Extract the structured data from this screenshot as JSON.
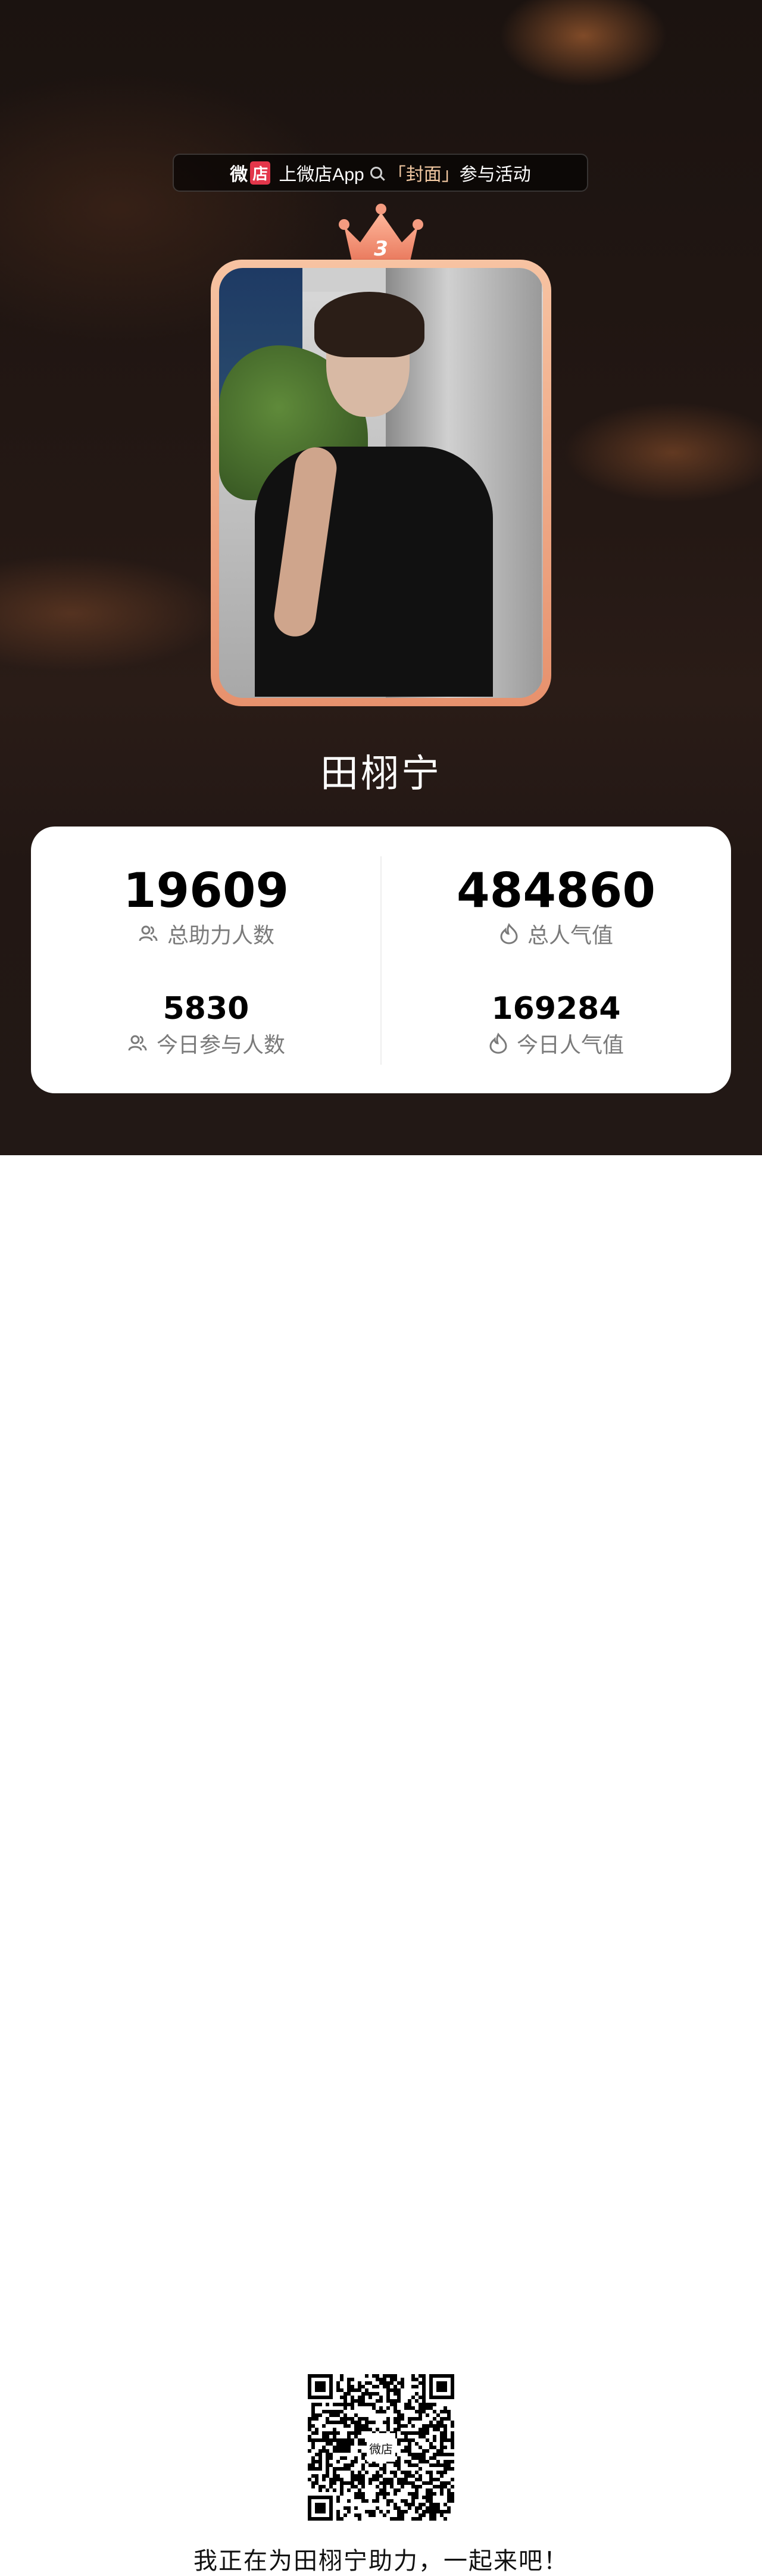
{
  "banner": {
    "logo_wei": "微",
    "logo_dian": "店",
    "text_prefix": "上微店App",
    "bracket_open": "「 ",
    "keyword": "封面",
    "bracket_close": " 」",
    "text_suffix": "参与活动"
  },
  "rank": {
    "value": "3",
    "icon": "crown-icon"
  },
  "profile": {
    "name": "田栩宁"
  },
  "stats": {
    "total_helpers": {
      "value": "19609",
      "label": "总助力人数",
      "icon": "people-icon"
    },
    "total_popularity": {
      "value": "484860",
      "label": "总人气值",
      "icon": "flame-icon"
    },
    "today_participants": {
      "value": "5830",
      "label": "今日参与人数",
      "icon": "people-icon"
    },
    "today_popularity": {
      "value": "169284",
      "label": "今日人气值",
      "icon": "flame-icon"
    }
  },
  "footer": {
    "qr_logo": "微店",
    "message": "我正在为田栩宁助力，一起来吧！"
  },
  "colors": {
    "accent": "#e3364a",
    "crown": "#f28b6c",
    "frame": "#f2a888",
    "dark_bg": "#221714"
  }
}
